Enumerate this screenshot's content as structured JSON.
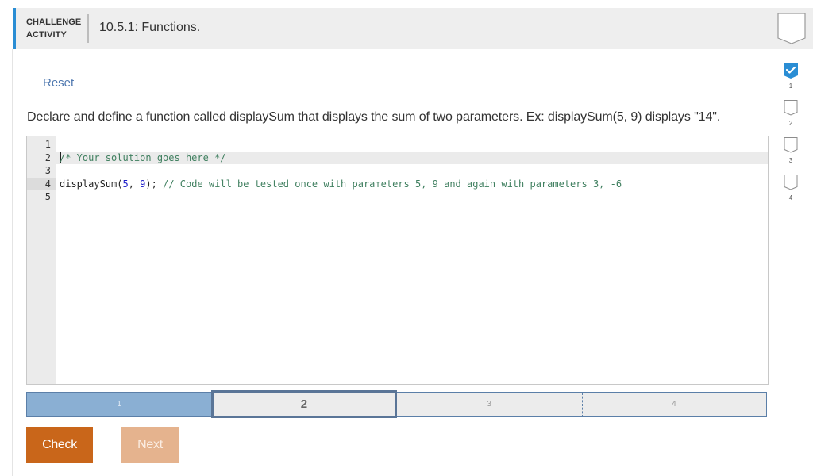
{
  "header": {
    "kind_line1": "CHALLENGE",
    "kind_line2": "ACTIVITY",
    "title": "10.5.1: Functions.",
    "accent_color": "#2a8dd4",
    "completion_flag_icon": "empty-shield-icon"
  },
  "reset_label": "Reset",
  "instructions": "Declare and define a function called displaySum that displays the sum of two parameters. Ex: displaySum(5, 9) displays \"14\".",
  "editor": {
    "line_numbers": [
      "1",
      "2",
      "3",
      "4",
      "5"
    ],
    "active_line": 2,
    "lines": [
      {
        "segments": []
      },
      {
        "segments": [
          {
            "text": "/* Your solution goes here */",
            "type": "comment"
          }
        ]
      },
      {
        "segments": []
      },
      {
        "segments": [
          {
            "text": "displaySum(",
            "type": "plain"
          },
          {
            "text": "5",
            "type": "num"
          },
          {
            "text": ", ",
            "type": "plain"
          },
          {
            "text": "9",
            "type": "num"
          },
          {
            "text": "); ",
            "type": "plain"
          },
          {
            "text": "// Code will be tested once with parameters 5, 9 and again with parameters 3, -6",
            "type": "comment"
          }
        ]
      },
      {
        "segments": []
      }
    ]
  },
  "progress": {
    "steps": [
      "1",
      "2",
      "3",
      "4"
    ],
    "completed": 1,
    "current": 2,
    "done_color": "#8aafd3"
  },
  "buttons": {
    "check_label": "Check",
    "next_label": "Next",
    "check_color": "#c9661a",
    "next_color": "#e5b38e"
  },
  "levels": [
    {
      "label": "1",
      "status": "completed",
      "icon": "checkmark-shield-icon"
    },
    {
      "label": "2",
      "status": "incomplete",
      "icon": "empty-shield-icon"
    },
    {
      "label": "3",
      "status": "incomplete",
      "icon": "empty-shield-icon"
    },
    {
      "label": "4",
      "status": "incomplete",
      "icon": "empty-shield-icon"
    }
  ]
}
